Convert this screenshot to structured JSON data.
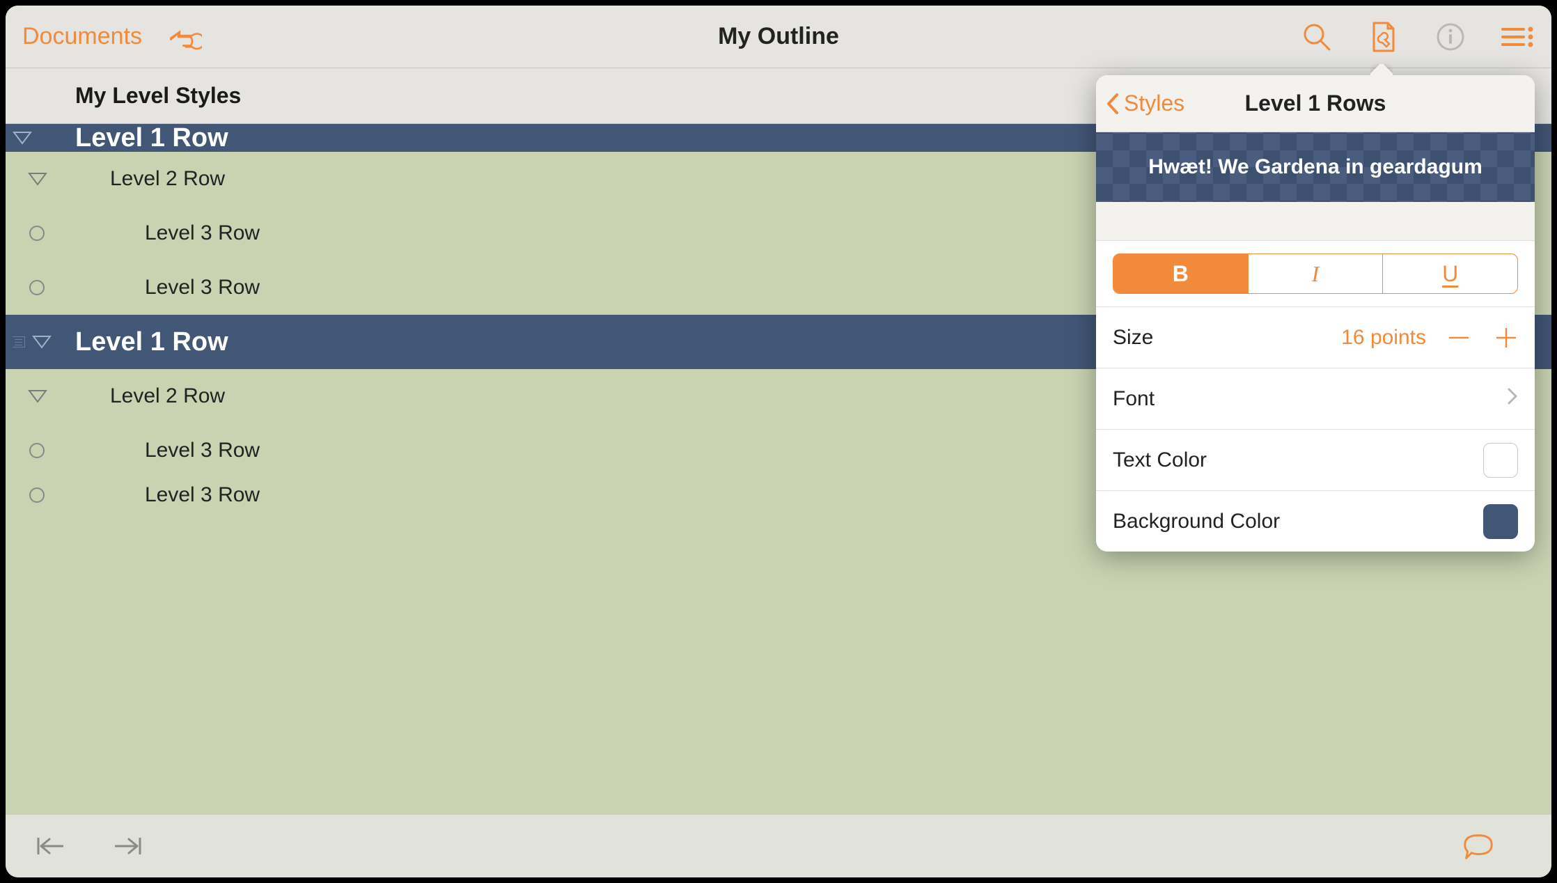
{
  "toolbar": {
    "documents_label": "Documents",
    "title": "My Outline"
  },
  "column_header_label": "My Level Styles",
  "rows": [
    {
      "level": 1,
      "label": "Level 1 Row",
      "partial": "top"
    },
    {
      "level": 2,
      "label": "Level 2 Row"
    },
    {
      "level": 3,
      "label": "Level 3 Row"
    },
    {
      "level": 3,
      "label": "Level 3 Row"
    },
    {
      "level": 1,
      "label": "Level 1 Row",
      "has_note": true
    },
    {
      "level": 2,
      "label": "Level 2 Row"
    },
    {
      "level": 3,
      "label": "Level 3 Row"
    },
    {
      "level": 3,
      "label": "Level 3 Row",
      "partial": "bot"
    }
  ],
  "popover": {
    "back_label": "Styles",
    "title": "Level 1 Rows",
    "preview_text": "Hwæt! We Gardena in geardagum",
    "format": {
      "bold": true,
      "italic": false,
      "underline": false,
      "b_glyph": "B",
      "i_glyph": "I",
      "u_glyph": "U"
    },
    "size_label": "Size",
    "size_value": "16 points",
    "font_label": "Font",
    "text_color_label": "Text Color",
    "bg_color_label": "Background Color",
    "text_color_value": "#ffffff",
    "bg_color_value": "#425676"
  },
  "colors": {
    "accent": "#f28a3c",
    "level1_bg": "#425676"
  }
}
